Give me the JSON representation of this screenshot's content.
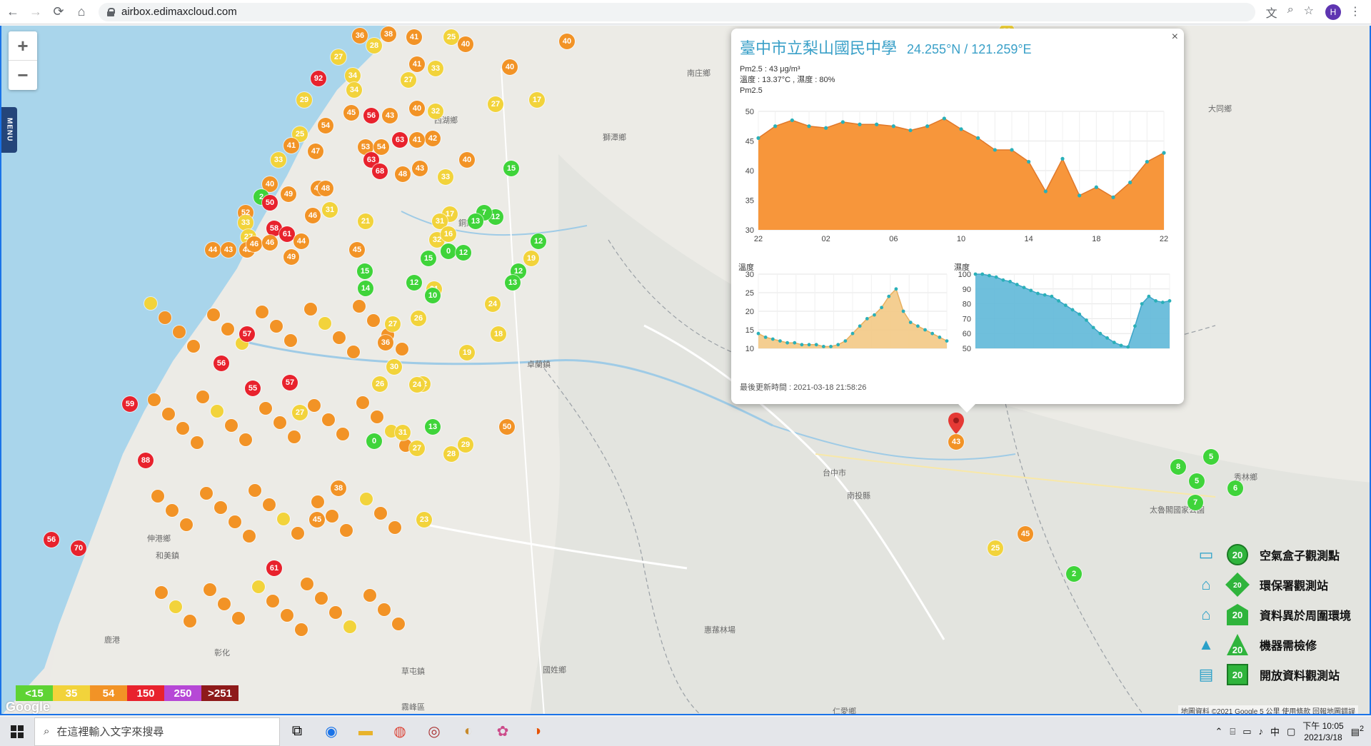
{
  "browser": {
    "url": "airbox.edimaxcloud.com",
    "back": "←",
    "forward": "→",
    "reload": "⟳",
    "home": "⌂",
    "profile_initial": "H"
  },
  "map": {
    "zoom_in": "+",
    "zoom_out": "−",
    "menu_label": "MENU",
    "places": [
      {
        "name": "南庄鄉"
      },
      {
        "name": "獅潭鄉"
      },
      {
        "name": "大同鄉"
      },
      {
        "name": "西湖鄉"
      },
      {
        "name": "銅鑼鄉"
      },
      {
        "name": "卓蘭鎮"
      },
      {
        "name": "伸港鄉"
      },
      {
        "name": "和美鎮"
      },
      {
        "name": "鹿港"
      },
      {
        "name": "彰化"
      },
      {
        "name": "惠蓀林場"
      },
      {
        "name": "國姓鄉"
      },
      {
        "name": "秀林鄉"
      },
      {
        "name": "太魯閣國家公園"
      },
      {
        "name": "仁愛鄉"
      },
      {
        "name": "台中市"
      },
      {
        "name": "南投縣"
      },
      {
        "name": "草屯鎮"
      },
      {
        "name": "霧峰區"
      }
    ],
    "copyright": "地圖資料 ©2021 Google   5 公里   使用條款   回報地圖錯誤",
    "google": "Google"
  },
  "popup": {
    "title": "臺中市立梨山國民中學",
    "coords": "24.255°N / 121.259°E",
    "pm25_line": "Pm2.5 : 43 μg/m³",
    "temp_line": "溫度 : 13.37°C , 濕度 : 80%",
    "chart_label": "Pm2.5",
    "temp_label": "溫度",
    "hum_label": "濕度",
    "updated": "最後更新時間 : 2021-03-18 21:58:26",
    "close": "×"
  },
  "chart_data": [
    {
      "type": "area",
      "title": "Pm2.5",
      "x": [
        "22",
        "23",
        "00",
        "01",
        "02",
        "03",
        "04",
        "05",
        "06",
        "07",
        "08",
        "09",
        "10",
        "11",
        "12",
        "13",
        "14",
        "15",
        "16",
        "17",
        "18",
        "19",
        "20",
        "21",
        "22"
      ],
      "xticks": [
        "22",
        "02",
        "06",
        "10",
        "14",
        "18",
        "22"
      ],
      "values": [
        45.5,
        47.5,
        48.5,
        47.5,
        47.2,
        48.2,
        47.8,
        47.8,
        47.5,
        46.8,
        47.5,
        48.8,
        47,
        45.5,
        43.5,
        43.5,
        41.5,
        36.5,
        42,
        35.8,
        37.2,
        35.5,
        38,
        41.5,
        43
      ],
      "ylim": [
        30,
        50
      ],
      "yticks": [
        30,
        35,
        40,
        45,
        50
      ],
      "color": "#f7963b"
    },
    {
      "type": "area",
      "title": "溫度",
      "values": [
        14,
        13,
        12.5,
        12,
        11.5,
        11.5,
        11,
        11,
        11,
        10.5,
        10.5,
        11,
        12,
        14,
        16,
        18,
        19,
        21,
        24,
        26,
        20,
        17,
        16,
        15,
        14,
        13,
        12
      ],
      "ylim": [
        10,
        30
      ],
      "yticks": [
        10,
        15,
        20,
        25,
        30
      ],
      "color": "#f3c985"
    },
    {
      "type": "area",
      "title": "濕度",
      "values": [
        100,
        100,
        99,
        98,
        96,
        95,
        93,
        91,
        89,
        87,
        86,
        85,
        82,
        79,
        76,
        73,
        69,
        64,
        60,
        57,
        54,
        52,
        51,
        65,
        80,
        85,
        82,
        81,
        82
      ],
      "ylim": [
        50,
        100
      ],
      "yticks": [
        50,
        60,
        70,
        80,
        90,
        100
      ],
      "color": "#5fb8d8"
    }
  ],
  "aqi_legend": [
    {
      "label": "<15",
      "color": "#5ed334"
    },
    {
      "label": "35",
      "color": "#f2d33b"
    },
    {
      "label": "54",
      "color": "#f29326"
    },
    {
      "label": "150",
      "color": "#e8222d"
    },
    {
      "label": "250",
      "color": "#b648d6"
    },
    {
      "label": ">251",
      "color": "#8e1a1a"
    }
  ],
  "right_legend": [
    {
      "label": "空氣盒子觀測點",
      "badge": "20",
      "icon": "airbox-icon"
    },
    {
      "label": "環保署觀測站",
      "badge": "20",
      "icon": "government-icon"
    },
    {
      "label": "資料異於周圍環境",
      "badge": "20",
      "icon": "house-icon"
    },
    {
      "label": "機器需檢修",
      "badge": "20",
      "icon": "tower-icon"
    },
    {
      "label": "開放資料觀測站",
      "badge": "20",
      "icon": "opendata-icon"
    }
  ],
  "selected_marker": {
    "value": "43"
  },
  "markers": [
    {
      "v": "36",
      "c": "o"
    },
    {
      "v": "38",
      "c": "o"
    },
    {
      "v": "41",
      "c": "o"
    },
    {
      "v": "25",
      "c": "y"
    },
    {
      "v": "40",
      "c": "o"
    },
    {
      "v": "27",
      "c": "y"
    },
    {
      "v": "28",
      "c": "y"
    },
    {
      "v": "92",
      "c": "r"
    },
    {
      "v": "34",
      "c": "y"
    },
    {
      "v": "29",
      "c": "y"
    },
    {
      "v": "34",
      "c": "y"
    },
    {
      "v": "41",
      "c": "o"
    },
    {
      "v": "27",
      "c": "y"
    },
    {
      "v": "33",
      "c": "y"
    },
    {
      "v": "40",
      "c": "o"
    },
    {
      "v": "45",
      "c": "o"
    },
    {
      "v": "56",
      "c": "r"
    },
    {
      "v": "43",
      "c": "o"
    },
    {
      "v": "40",
      "c": "o"
    },
    {
      "v": "32",
      "c": "y"
    },
    {
      "v": "27",
      "c": "y"
    },
    {
      "v": "17",
      "c": "y"
    },
    {
      "v": "42",
      "c": "o"
    },
    {
      "v": "25",
      "c": "y"
    },
    {
      "v": "22",
      "c": "y"
    },
    {
      "v": "40",
      "c": "o"
    },
    {
      "v": "54",
      "c": "o"
    },
    {
      "v": "63",
      "c": "r"
    },
    {
      "v": "41",
      "c": "o"
    },
    {
      "v": "41",
      "c": "o"
    },
    {
      "v": "47",
      "c": "o"
    },
    {
      "v": "53",
      "c": "o"
    },
    {
      "v": "54",
      "c": "o"
    },
    {
      "v": "33",
      "c": "y"
    },
    {
      "v": "63",
      "c": "r"
    },
    {
      "v": "68",
      "c": "r"
    },
    {
      "v": "48",
      "c": "o"
    },
    {
      "v": "43",
      "c": "o"
    },
    {
      "v": "40",
      "c": "o"
    },
    {
      "v": "33",
      "c": "y"
    },
    {
      "v": "15",
      "c": "g"
    },
    {
      "v": "40",
      "c": "o"
    },
    {
      "v": "49",
      "c": "o"
    },
    {
      "v": "42",
      "c": "o"
    },
    {
      "v": "48",
      "c": "o"
    },
    {
      "v": "2",
      "c": "g"
    },
    {
      "v": "50",
      "c": "r"
    },
    {
      "v": "31",
      "c": "y"
    },
    {
      "v": "12",
      "c": "g"
    },
    {
      "v": "52",
      "c": "o"
    },
    {
      "v": "46",
      "c": "o"
    },
    {
      "v": "33",
      "c": "y"
    },
    {
      "v": "27",
      "c": "y"
    },
    {
      "v": "48",
      "c": "o"
    },
    {
      "v": "17",
      "c": "y"
    },
    {
      "v": "7",
      "c": "g"
    },
    {
      "v": "13",
      "c": "g"
    },
    {
      "v": "21",
      "c": "y"
    },
    {
      "v": "31",
      "c": "y"
    },
    {
      "v": "32",
      "c": "y"
    },
    {
      "v": "58",
      "c": "r"
    },
    {
      "v": "61",
      "c": "r"
    },
    {
      "v": "46",
      "c": "o"
    },
    {
      "v": "46",
      "c": "o"
    },
    {
      "v": "44",
      "c": "o"
    },
    {
      "v": "16",
      "c": "y"
    },
    {
      "v": "12",
      "c": "g"
    },
    {
      "v": "0",
      "c": "g"
    },
    {
      "v": "12",
      "c": "g"
    },
    {
      "v": "15",
      "c": "g"
    },
    {
      "v": "19",
      "c": "y"
    },
    {
      "v": "12",
      "c": "g"
    },
    {
      "v": "44",
      "c": "o"
    },
    {
      "v": "43",
      "c": "o"
    },
    {
      "v": "49",
      "c": "o"
    },
    {
      "v": "45",
      "c": "o"
    },
    {
      "v": "15",
      "c": "g"
    },
    {
      "v": "12",
      "c": "g"
    },
    {
      "v": "13",
      "c": "g"
    },
    {
      "v": "21",
      "c": "y"
    },
    {
      "v": "14",
      "c": "g"
    },
    {
      "v": "10",
      "c": "g"
    },
    {
      "v": "24",
      "c": "y"
    },
    {
      "v": "57",
      "c": "r"
    },
    {
      "v": "26",
      "c": "y"
    },
    {
      "v": "27",
      "c": "y"
    },
    {
      "v": "18",
      "c": "y"
    },
    {
      "v": "36",
      "c": "o"
    },
    {
      "v": "19",
      "c": "y"
    },
    {
      "v": "30",
      "c": "y"
    },
    {
      "v": "26",
      "c": "y"
    },
    {
      "v": "32",
      "c": "y"
    },
    {
      "v": "24",
      "c": "y"
    },
    {
      "v": "56",
      "c": "r"
    },
    {
      "v": "55",
      "c": "r"
    },
    {
      "v": "57",
      "c": "r"
    },
    {
      "v": "59",
      "c": "r"
    },
    {
      "v": "88",
      "c": "r"
    },
    {
      "v": "70",
      "c": "r"
    },
    {
      "v": "56",
      "c": "r"
    },
    {
      "v": "61",
      "c": "r"
    },
    {
      "v": "45",
      "c": "o"
    },
    {
      "v": "29",
      "c": "y"
    },
    {
      "v": "27",
      "c": "y"
    },
    {
      "v": "50",
      "c": "o"
    },
    {
      "v": "31",
      "c": "y"
    },
    {
      "v": "0",
      "c": "g"
    },
    {
      "v": "13",
      "c": "g"
    },
    {
      "v": "28",
      "c": "y"
    },
    {
      "v": "27",
      "c": "y"
    },
    {
      "v": "38",
      "c": "o"
    },
    {
      "v": "23",
      "c": "y"
    },
    {
      "v": "45",
      "c": "o"
    },
    {
      "v": "7",
      "c": "g"
    },
    {
      "v": "8",
      "c": "g"
    },
    {
      "v": "5",
      "c": "g"
    },
    {
      "v": "5",
      "c": "g"
    },
    {
      "v": "6",
      "c": "g"
    },
    {
      "v": "2",
      "c": "g"
    },
    {
      "v": "25",
      "c": "y"
    },
    {
      "v": "22",
      "c": "y"
    }
  ],
  "taskbar": {
    "search_placeholder": "在這裡輸入文字來搜尋",
    "time": "下午 10:05",
    "date": "2021/3/18",
    "ime": "中",
    "notif": "2"
  }
}
